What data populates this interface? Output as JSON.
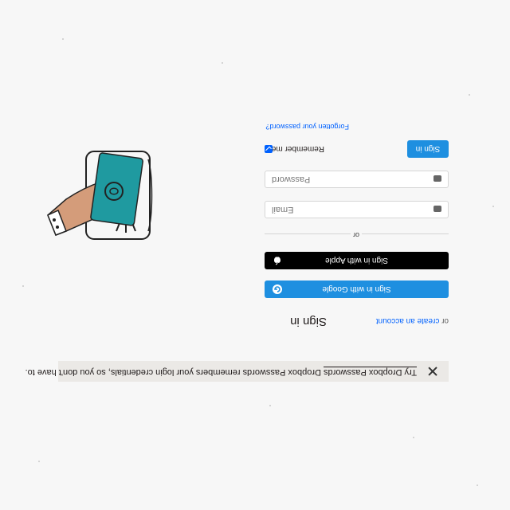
{
  "banner": {
    "message": "Dropbox Passwords remembers your login credentials, so you don't have to.",
    "link": "Try Dropbox Passwords"
  },
  "signin": {
    "title": "Sign in",
    "or": "or",
    "create_account": "create an account",
    "google_button": "Sign in with Google",
    "apple_button": "Sign in with Apple",
    "divider": "or",
    "email_placeholder": "Email",
    "password_placeholder": "Password",
    "submit": "Sign in",
    "remember_me": "Remember me",
    "forgot_password": "Forgotten your password?"
  },
  "colors": {
    "accent": "#1e8fe0",
    "link": "#0061fe",
    "banner_bg": "#ebe9e6"
  }
}
